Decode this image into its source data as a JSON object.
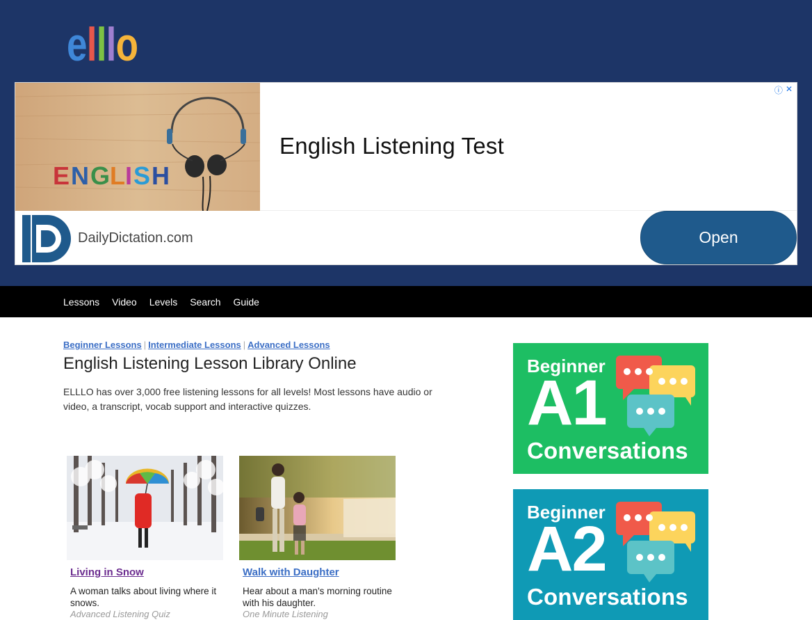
{
  "brand": {
    "logo_letters": [
      "e",
      "l",
      "l",
      "l",
      "o"
    ],
    "logo_colors": [
      "#3f87d8",
      "#e8574c",
      "#7dc243",
      "#9f7fd0",
      "#f5b43a"
    ],
    "header_color": "#1d3567"
  },
  "ad": {
    "image_word": "ENGLISH",
    "headline": "English Listening Test",
    "domain": "DailyDictation.com",
    "open_label": "Open",
    "choices_icons": [
      "info-icon",
      "close-icon"
    ]
  },
  "nav": {
    "items": [
      "Lessons",
      "Video",
      "Levels",
      "Search",
      "Guide"
    ]
  },
  "main": {
    "breadcrumbs": [
      "Beginner Lessons",
      "Intermediate Lessons",
      "Advanced Lessons"
    ],
    "title": "English Listening Lesson Library Online",
    "intro": "ELLLO has over 3,000 free listening lessons for all levels! Most lessons have audio or video, a transcript, vocab support and interactive quizzes.",
    "lessons": [
      {
        "title": "Living in Snow",
        "description": "A woman talks about living where it snows.",
        "category": "Advanced Listening Quiz",
        "title_color": "#6b2c8f"
      },
      {
        "title": "Walk with Daughter",
        "description": "Hear about a man's morning routine with his daughter.",
        "category": "One Minute Listening",
        "title_color": "#3b6ec5"
      }
    ]
  },
  "sidebar": {
    "banners": [
      {
        "small": "Beginner",
        "big": "A1",
        "label": "Conversations",
        "bg": "#1dbe63"
      },
      {
        "small": "Beginner",
        "big": "A2",
        "label": "Conversations",
        "bg": "#0f9ab5"
      }
    ]
  }
}
